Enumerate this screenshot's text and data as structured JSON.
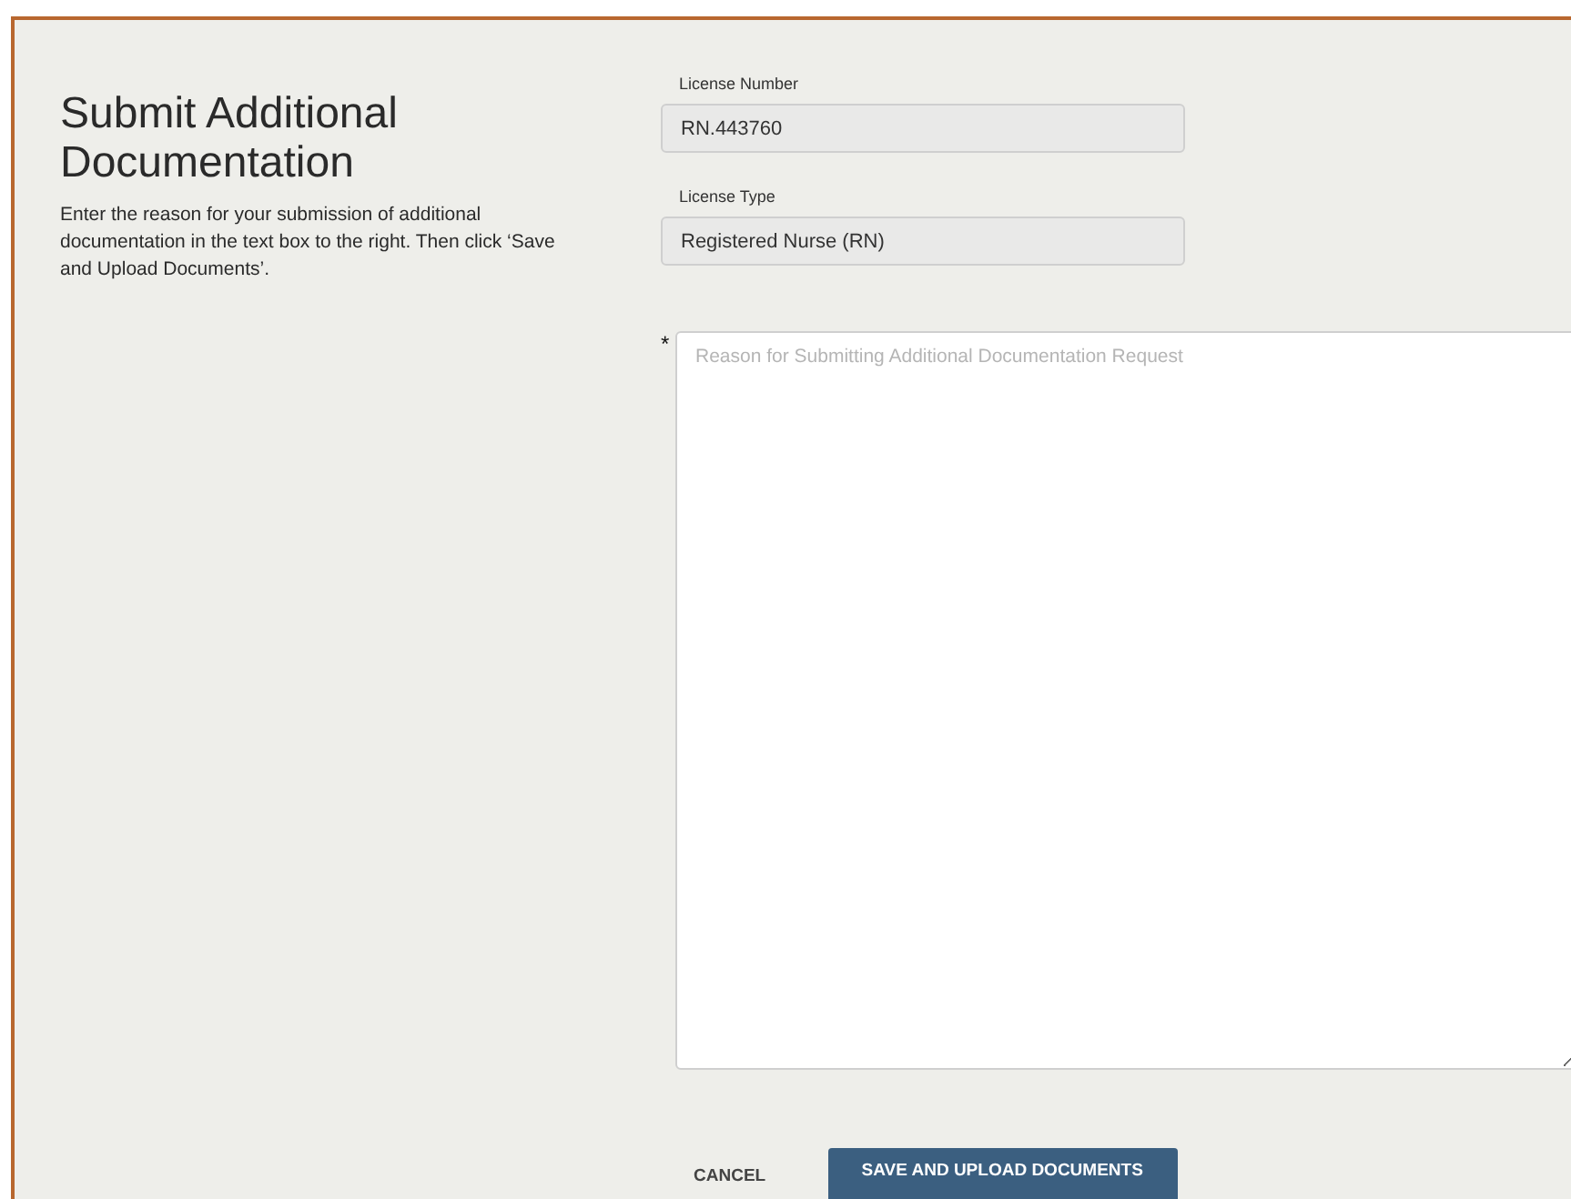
{
  "heading": "Submit Additional Documentation",
  "instructions": "Enter the reason for your submission of additional documentation in the text box to the right. Then click ‘Save and Upload Documents’.",
  "fields": [
    {
      "label": "License Number",
      "value": "RN.443760"
    },
    {
      "label": "License Type",
      "value": "Registered Nurse (RN)"
    }
  ],
  "reason": {
    "required_mark": "*",
    "placeholder": "Reason for Submitting Additional Documentation Request"
  },
  "buttons": [
    {
      "kind": "text",
      "label": "CANCEL"
    },
    {
      "kind": "primary",
      "label": "SAVE AND UPLOAD DOCUMENTS"
    }
  ]
}
